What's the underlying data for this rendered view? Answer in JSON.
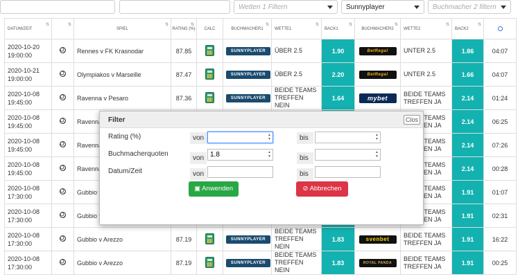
{
  "filters": {
    "wetten1_placeholder": "Wetten 1 Filtern",
    "bookmaker1_selected": "Sunnyplayer",
    "bookmaker2_placeholder": "Buchmacher 2 filtern"
  },
  "columns": [
    "DATUM/ZEIT",
    "",
    "SPIEL",
    "RATING (%)",
    "CALC",
    "BUCHMACHER1",
    "WETTE1",
    "BACK1",
    "BUCHMACHER2",
    "WETTE2",
    "BACK2",
    ""
  ],
  "rows": [
    {
      "date": "2020-10-20",
      "time": "19:00:00",
      "game": "Rennes v FK Krasnodar",
      "rating": "87.85",
      "bm1": "SUNNYPLAYER",
      "bet1": "ÜBER 2.5",
      "back1": "1.90",
      "bm2": "BetRegal",
      "bet2": "UNTER 2.5",
      "back2": "1.86",
      "remain": "04:07"
    },
    {
      "date": "2020-10-21",
      "time": "19:00:00",
      "game": "Olympiakos v Marseille",
      "rating": "87.47",
      "bm1": "SUNNYPLAYER",
      "bet1": "ÜBER 2.5",
      "back1": "2.20",
      "bm2": "BetRegal",
      "bet2": "UNTER 2.5",
      "back2": "1.66",
      "remain": "04:07"
    },
    {
      "date": "2020-10-08",
      "time": "19:45:00",
      "game": "Ravenna v Pesaro",
      "rating": "87.36",
      "bm1": "SUNNYPLAYER",
      "bet1": "BEIDE TEAMS TREFFEN NEIN",
      "back1": "1.64",
      "bm2": "mybet",
      "bet2": "BEIDE TEAMS TREFFEN JA",
      "back2": "2.14",
      "remain": "01:24"
    },
    {
      "date": "2020-10-08",
      "time": "19:45:00",
      "game": "Ravenna",
      "rating": "",
      "bm1": "",
      "bet1": "",
      "back1": "",
      "bm2": "",
      "bet2": "BEIDE TEAMS TREFFEN JA",
      "back2": "2.14",
      "remain": "06:25"
    },
    {
      "date": "2020-10-08",
      "time": "19:45:00",
      "game": "Ravenna",
      "rating": "",
      "bm1": "",
      "bet1": "",
      "back1": "",
      "bm2": "",
      "bet2": "BEIDE TEAMS TREFFEN JA",
      "back2": "2.14",
      "remain": "07:26"
    },
    {
      "date": "2020-10-08",
      "time": "19:45:00",
      "game": "Ravenna",
      "rating": "",
      "bm1": "",
      "bet1": "",
      "back1": "",
      "bm2": "",
      "bet2": "BEIDE TEAMS TREFFEN JA",
      "back2": "2.14",
      "remain": "00:28"
    },
    {
      "date": "2020-10-08",
      "time": "17:30:00",
      "game": "Gubbio v",
      "rating": "",
      "bm1": "",
      "bet1": "",
      "back1": "",
      "bm2": "",
      "bet2": "BEIDE TEAMS TREFFEN JA",
      "back2": "1.91",
      "remain": "01:07"
    },
    {
      "date": "2020-10-08",
      "time": "17:30:00",
      "game": "Gubbio v",
      "rating": "",
      "bm1": "",
      "bet1": "",
      "back1": "",
      "bm2": "",
      "bet2": "BEIDE TEAMS TREFFEN JA",
      "back2": "1.91",
      "remain": "02:31"
    },
    {
      "date": "2020-10-08",
      "time": "17:30:00",
      "game": "Gubbio v Arezzo",
      "rating": "87.19",
      "bm1": "SUNNYPLAYER",
      "bet1": "BEIDE TEAMS TREFFEN NEIN",
      "back1": "1.83",
      "bm2": "svenbet",
      "bet2": "BEIDE TEAMS TREFFEN JA",
      "back2": "1.91",
      "remain": "16:22"
    },
    {
      "date": "2020-10-08",
      "time": "17:30:00",
      "game": "Gubbio v Arezzo",
      "rating": "87.19",
      "bm1": "SUNNYPLAYER",
      "bet1": "BEIDE TEAMS TREFFEN NEIN",
      "back1": "1.83",
      "bm2": "ROYAL PANDA",
      "bet2": "BEIDE TEAMS TREFFEN JA",
      "back2": "1.91",
      "remain": "00:25"
    }
  ],
  "modal": {
    "title": "Filter",
    "close_label": "Clos",
    "rating_label": "Rating (%)",
    "odds_label": "Buchmacherquoten",
    "date_label": "Datum/Zeit",
    "from_label": "von",
    "to_label": "bis",
    "odds_from_value": "1.8",
    "apply_label": "Anwenden",
    "cancel_label": "Abbrechen"
  }
}
